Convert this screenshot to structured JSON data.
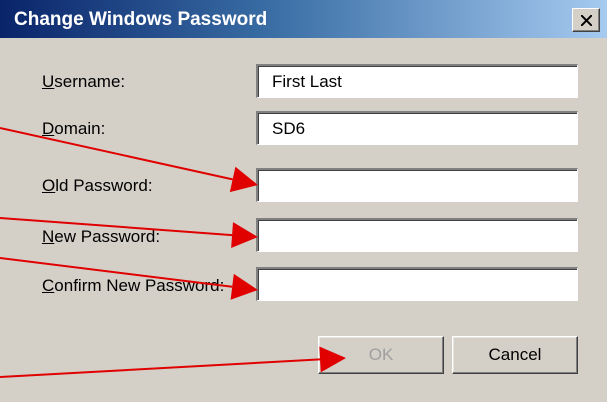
{
  "dialog": {
    "title": "Change Windows Password",
    "close_icon": "close-x-icon"
  },
  "form": {
    "username": {
      "label_mnemonic": "U",
      "label_rest": "sername:",
      "value": "First Last"
    },
    "domain": {
      "label_mnemonic": "D",
      "label_rest": "omain:",
      "value": "SD6"
    },
    "old_password": {
      "label_mnemonic": "O",
      "label_rest": "ld Password:",
      "value": ""
    },
    "new_password": {
      "label_mnemonic": "N",
      "label_rest": "ew Password:",
      "value": ""
    },
    "confirm_password": {
      "label_mnemonic": "C",
      "label_rest": "onfirm New Password:",
      "value": ""
    }
  },
  "buttons": {
    "ok": {
      "label": "OK",
      "enabled": false
    },
    "cancel": {
      "label": "Cancel",
      "enabled": true
    }
  },
  "annotation": {
    "arrow_color": "#e00000"
  }
}
